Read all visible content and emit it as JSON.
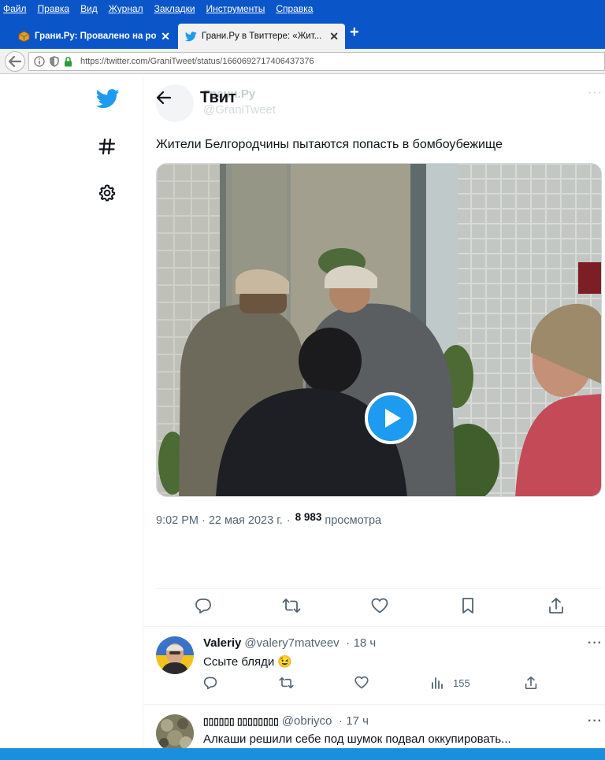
{
  "browser": {
    "menu": [
      "Файл",
      "Правка",
      "Вид",
      "Журнал",
      "Закладки",
      "Инструменты",
      "Справка"
    ],
    "tabs": [
      {
        "title": "Грани.Ру: Провалено на род...",
        "active": false,
        "favicon": "package-icon"
      },
      {
        "title": "Грани.Ру в Твиттере: «Жит...",
        "active": true,
        "favicon": "twitter-bird-icon"
      }
    ],
    "tab_close": "✕",
    "new_tab": "+",
    "url": "https://twitter.com/GraniTweet/status/1660692717406437376"
  },
  "header": {
    "title": "Твит",
    "ghost_name": "Грани.Ру",
    "ghost_handle": "@GraniTweet",
    "more": "···"
  },
  "tweet": {
    "text": "Жители Белгородчины пытаются попасть в бомбоубежище",
    "time": "9:02 PM",
    "date": "22 мая 2023 г.",
    "sep": "·",
    "views": "8 983",
    "views_label": "просмотра"
  },
  "replies": [
    {
      "name": "Valeriy",
      "handle": "@valery7matveev",
      "age": "18 ч",
      "text": "Ссыте бляди",
      "emoji": "😉",
      "views": "155"
    },
    {
      "name": "▯▯▯▯▯▯ ▯▯▯▯▯▯▯▯",
      "handle": "@obriyco",
      "age": "17 ч",
      "text": "Алкаши решили себе под шумок подвал оккупировать..."
    }
  ],
  "colors": {
    "brand": "#1d9bf0",
    "chrome_blue": "#0a55c8",
    "text_secondary": "#536471"
  }
}
